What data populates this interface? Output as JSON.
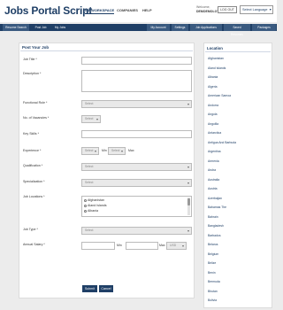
{
  "header": {
    "logo": "Jobs Portal Script",
    "nav": [
      "MY WORKSPACE",
      "COMPANIES",
      "HELP"
    ],
    "welcome_label": "Welcome,",
    "username": "DEMOEMOLOYEE",
    "logout_label": "LOG OUT",
    "language_label": "Select Language"
  },
  "navbar": {
    "left": [
      "Resume Search",
      "Post Job",
      "My Jobs"
    ],
    "right": [
      "My Account",
      "Settings",
      "Job Applications",
      "Saved Resumes",
      "Packages"
    ]
  },
  "form": {
    "title": "Post Your Job",
    "job_title_label": "Job Title",
    "description_label": "Description",
    "functional_role_label": "Functional Role",
    "select_placeholder": "Select",
    "vacancies_label": "No. of Vacancies",
    "key_skills_label": "Key Skills",
    "experience_label": "Experience",
    "min_label": "Min",
    "max_label": "Max",
    "qualification_label": "Qualification",
    "specialization_label": "Specialization",
    "job_locations_label": "Job Locations",
    "location_options": [
      "Afghanistan",
      "Aland Islands",
      "Albania"
    ],
    "job_type_label": "Job Type",
    "annual_salary_label": "Annual Salary",
    "currency_value": "USD",
    "submit_label": "Submit",
    "cancel_label": "Cancel"
  },
  "locations": {
    "title": "Location",
    "items": [
      "Afghanistan",
      "Aland Islands",
      "Albania",
      "Algeria",
      "American Samoa",
      "Andorra",
      "Angola",
      "Anguilla",
      "Antarctica",
      "Antigua And Barbuda",
      "Argentina",
      "Armenia",
      "Aruba",
      "Australia",
      "Austria",
      "Azerbaijan",
      "Bahamas The",
      "Bahrain",
      "Bangladesh",
      "Barbados",
      "Belarus",
      "Belgium",
      "Belize",
      "Benin",
      "Bermuda",
      "Bhutan",
      "Bolivia"
    ]
  }
}
